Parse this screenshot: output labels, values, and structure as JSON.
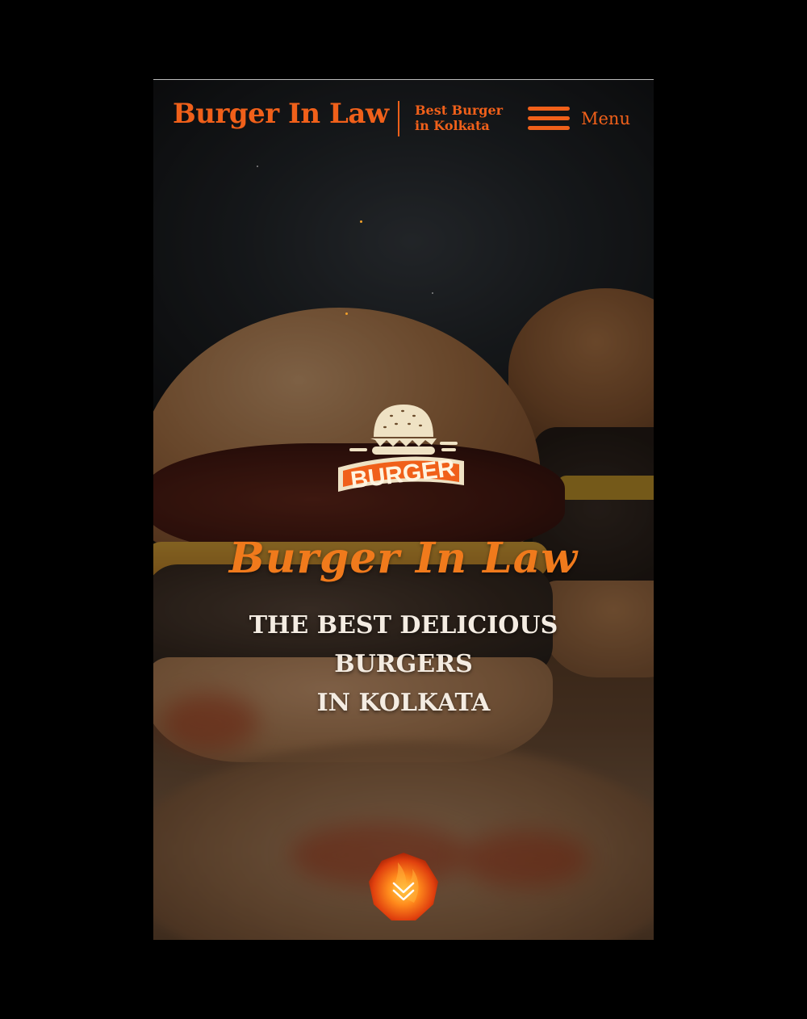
{
  "header": {
    "brand_name": "Burger In Law",
    "tagline_line1": "Best Burger",
    "tagline_line2": "in Kolkata",
    "menu_label": "Menu"
  },
  "hero": {
    "logo_text": "BURGER",
    "script_title": "Burger In Law",
    "headline_line1": "THE BEST DELICIOUS BURGERS",
    "headline_line2": "IN KOLKATA"
  },
  "colors": {
    "brand_orange": "#f0601a",
    "script_orange": "#f07a1c",
    "headline_text": "#f4ece2",
    "page_background": "#000000"
  },
  "icons": {
    "menu": "hamburger-icon",
    "logo": "burger-logo-icon",
    "scroll": "chevron-double-down-icon"
  }
}
